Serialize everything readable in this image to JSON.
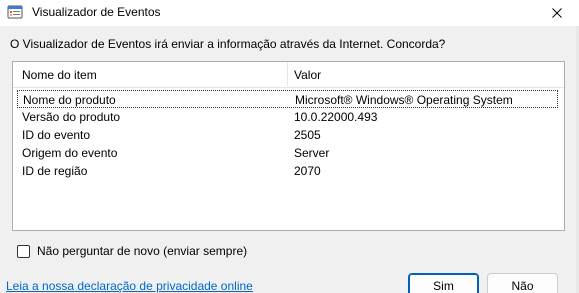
{
  "window": {
    "title": "Visualizador de Eventos",
    "icon": "event-viewer-icon"
  },
  "prompt": "O Visualizador de Eventos irá enviar a informação através da Internet. Concorda?",
  "list": {
    "columns": [
      "Nome do item",
      "Valor"
    ],
    "rows": [
      {
        "name": "Nome do produto",
        "value": "Microsoft® Windows® Operating System"
      },
      {
        "name": "Versão do produto",
        "value": "10.0.22000.493"
      },
      {
        "name": "ID do evento",
        "value": "2505"
      },
      {
        "name": "Origem do evento",
        "value": "Server"
      },
      {
        "name": "ID de região",
        "value": "2070"
      }
    ]
  },
  "checkbox": {
    "label": "Não perguntar de novo (enviar sempre)",
    "checked": false
  },
  "privacy_link": "Leia a nossa declaração de privacidade online",
  "buttons": {
    "yes": "Sim",
    "no": "Não"
  },
  "colors": {
    "link": "#0066cc",
    "primary_border": "#005fb8"
  }
}
